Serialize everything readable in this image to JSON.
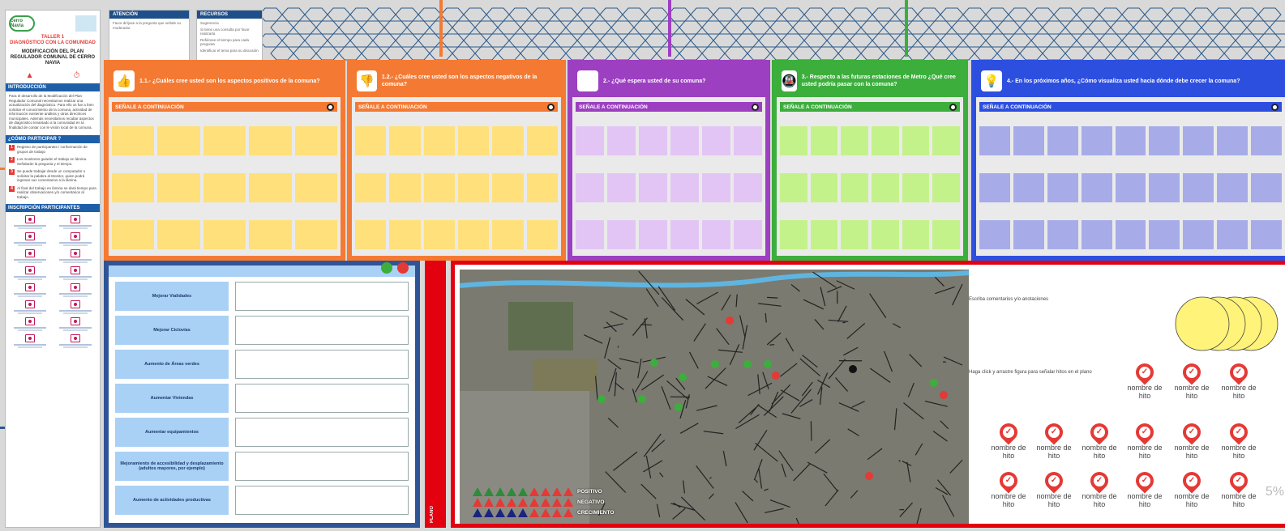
{
  "left_panel": {
    "logo": "cerro Navia",
    "taller": "TALLER 1",
    "diagnostico": "DIAGNÓSTICO CON LA COMUNIDAD",
    "modificacion": "MODIFICACIÓN DEL PLAN REGULADOR COMUNAL DE CERRO NAVIA",
    "introduccion_label": "INTRODUCCIÓN",
    "introduccion_text": "Para el desarrollo de la Modificación del Plan Regulador Comunal necesitamos realizar una actualización del diagnóstico. Para ello os fue a bien solicitar el conocimiento de la comuna, actividad de información existente análisis y otras directrices municipales. Además necesitamos recabar aspectos de diagnóstico levantado a la comunidad en la finalidad de contar con le visión local de la comuna.",
    "como_label": "¿CÓMO PARTICIPAR ?",
    "steps": [
      {
        "n": "1",
        "text": "Registro de participantes / conformación de grupos de trabajo"
      },
      {
        "n": "2",
        "text": "Los monitores guiarán el trabajo en lámina. Señalarán la pregunta y el tiempo."
      },
      {
        "n": "3",
        "text": "Se puede trabajar desde un computador o solicitar la palabra al Monitor, quien podrá ingresar sus comentarios a la lámina."
      },
      {
        "n": "4",
        "text": "Al final del trabajo en lámina se dará tiempo para realizar observaciones y/o comentarios al trabajo."
      }
    ],
    "inscripcion_label": "INSCRIPCIÓN PARTICIPANTES"
  },
  "mini_cards": {
    "atencion_title": "ATENCIÓN",
    "atencion_text": "Favor diríjase a la pregunta que señale su moderador.",
    "recursos_title": "RECURSOS",
    "recursos_items": [
      "Sugerencia",
      "Si tiene una consulta por favor realizarla",
      "Refiérase el tiempo para cada pregunta",
      "Identificar el tema para su discusión"
    ]
  },
  "questions": [
    {
      "title": "1.1.- ¿Cuáles cree usted son los aspectos positivos de la comuna?",
      "sub": "SEÑALE A CONTINUACIÓN",
      "icon": "thumbs-up-icon",
      "glyph": "👍",
      "color": "#f47a33",
      "note": "#ffe07a"
    },
    {
      "title": "1.2.- ¿Cuáles cree usted son los aspectos negativos de la comuna?",
      "sub": "SEÑALE A CONTINUACIÓN",
      "icon": "thumbs-down-icon",
      "glyph": "👎",
      "color": "#f47a33",
      "note": "#ffe07a"
    },
    {
      "title": "2.- ¿Qué espera usted de su comuna?",
      "sub": "SEÑALE A CONTINUACIÓN",
      "icon": "comuna-icon",
      "glyph": "🏙",
      "color": "#9c3fc1",
      "note": "#e3c5f5"
    },
    {
      "title": "3.- Respecto a las futuras estaciones de Metro ¿Qué cree usted podría pasar con la comuna?",
      "sub": "SEÑALE A CONTINUACIÓN",
      "icon": "metro-icon",
      "glyph": "🚇",
      "color": "#3cae3c",
      "note": "#c4f28a"
    },
    {
      "title": "4.- En los próximos años, ¿Cómo visualiza usted hacia dónde debe crecer la comuna?",
      "sub": "SEÑALE A CONTINUACIÓN",
      "icon": "lightbulb-icon",
      "glyph": "💡",
      "color": "#2d4fe0",
      "note": "#a7ace8"
    }
  ],
  "table": {
    "rows": [
      "Mejorar Vialidades",
      "Mejorar Ciclovías",
      "Aumento de Áreas verdes",
      "Aumentar Viviendas",
      "Aumentar equipamientos",
      "Mejoramiento de accesibilidad y desplazamiento (adultos mayores, por ejemplo)",
      "Aumento de actividades productivas"
    ]
  },
  "plano": {
    "side_label": "PLANO",
    "legend": [
      {
        "label": "POSITIVO",
        "colors": [
          "#2e8b3a",
          "#e53935"
        ]
      },
      {
        "label": "NEGATIVO",
        "colors": [
          "#e53935",
          "#e53935"
        ]
      },
      {
        "label": "CRECIMIENTO",
        "colors": [
          "#1a237e",
          "#e53935"
        ]
      }
    ],
    "comment_hint": "Escriba comentarios y/o anotaciones",
    "drag_hint": "Haga click y arrastre figura para señalar hitos en el plano",
    "hito_label": "nombre de hito",
    "zoom": "5%"
  }
}
